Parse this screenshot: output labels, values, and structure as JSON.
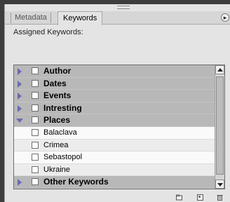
{
  "panel": {
    "tabs": [
      {
        "label": "Metadata",
        "active": false
      },
      {
        "label": "Keywords",
        "active": true
      }
    ],
    "menu_icon": "panel-menu-icon",
    "assigned_label": "Assigned Keywords:",
    "assigned_value": ""
  },
  "keywords": [
    {
      "label": "Author",
      "type": "parent",
      "expanded": false
    },
    {
      "label": "Dates",
      "type": "parent",
      "expanded": false
    },
    {
      "label": "Events",
      "type": "parent",
      "expanded": false
    },
    {
      "label": "Intresting",
      "type": "parent",
      "expanded": false
    },
    {
      "label": "Places",
      "type": "parent",
      "expanded": true
    },
    {
      "label": "Balaclava",
      "type": "child"
    },
    {
      "label": "Crimea",
      "type": "child"
    },
    {
      "label": "Sebastopol",
      "type": "child"
    },
    {
      "label": "Ukraine",
      "type": "child"
    },
    {
      "label": "Other Keywords",
      "type": "parent",
      "expanded": false
    }
  ],
  "bottom_icons": [
    "new-keyword-set-icon",
    "new-keyword-icon",
    "delete-keyword-icon"
  ],
  "colors": {
    "disclosure": "#6a6ab4",
    "parent_row": "#b8b8b8",
    "panel_bg": "#e4e4e4"
  }
}
